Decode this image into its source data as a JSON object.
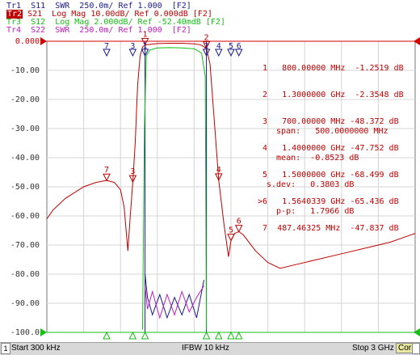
{
  "traces": [
    {
      "id": "tr1",
      "text": "Tr1  S11  SWR  250.0m/ Ref 1.000  [F2]",
      "color": "#1b1b8a"
    },
    {
      "id": "tr2",
      "tag": "Tr2",
      "text": " S21  Log Mag 10.00dB/ Ref 0.000dB [F2]",
      "color": "#c00000"
    },
    {
      "id": "tr3",
      "text": "Tr3  S12  Log Mag 2.000dB/ Ref -52.40mdB [F2]",
      "color": "#13c013"
    },
    {
      "id": "tr4",
      "text": "Tr4  S22  SWR  250.0m/ Ref 1.000  [F2]",
      "color": "#c020c0"
    }
  ],
  "y_labels": [
    "0.000",
    "-10.00",
    "-20.00",
    "-30.00",
    "-40.00",
    "-50.00",
    "-60.00",
    "-70.00",
    "-80.00",
    "-90.00",
    "-100.0"
  ],
  "marker_table": [
    " 1   800.00000 MHz  -1.2519 dB",
    " 2   1.3000000 GHz  -2.3548 dB",
    " 3   700.00000 MHz -48.372 dB",
    " 4   1.4000000 GHz -47.752 dB",
    " 5   1.5000000 GHz -68.499 dB",
    ">6   1.5640339 GHz -65.436 dB",
    " 7  487.46325 MHz  -47.837 dB"
  ],
  "stats": [
    "  span:   500.0000000 MHz",
    "  mean:  -0.8523 dB",
    "s.dev:   0.3803 dB",
    "  p-p:   1.7966 dB"
  ],
  "status": {
    "channel": "1",
    "start": "Start 300 kHz",
    "ifbw": "IFBW 10 kHz",
    "stop": "Stop 3 GHz",
    "cor": "Cor"
  },
  "chart_data": {
    "type": "line",
    "x_range_hz": [
      300000,
      3000000000
    ],
    "ylim": [
      -100,
      0
    ],
    "y_unit": "dB",
    "grid": true,
    "series": [
      {
        "name": "S21",
        "color": "#c00000",
        "points": [
          [
            0.0003,
            -61
          ],
          [
            0.05,
            -58
          ],
          [
            0.15,
            -54
          ],
          [
            0.3,
            -50
          ],
          [
            0.4,
            -48.5
          ],
          [
            0.4875,
            -47.8
          ],
          [
            0.55,
            -48.5
          ],
          [
            0.6,
            -51
          ],
          [
            0.63,
            -57
          ],
          [
            0.66,
            -72
          ],
          [
            0.68,
            -60
          ],
          [
            0.7,
            -48.4
          ],
          [
            0.72,
            -35
          ],
          [
            0.74,
            -15
          ],
          [
            0.76,
            -5
          ],
          [
            0.78,
            -2
          ],
          [
            0.8,
            -1.25
          ],
          [
            0.9,
            -0.8
          ],
          [
            1.0,
            -0.7
          ],
          [
            1.1,
            -0.7
          ],
          [
            1.2,
            -0.9
          ],
          [
            1.25,
            -1.2
          ],
          [
            1.3,
            -2.35
          ],
          [
            1.33,
            -8
          ],
          [
            1.36,
            -25
          ],
          [
            1.4,
            -47.75
          ],
          [
            1.44,
            -62
          ],
          [
            1.48,
            -74
          ],
          [
            1.5,
            -68.5
          ],
          [
            1.53,
            -66
          ],
          [
            1.564,
            -65.4
          ],
          [
            1.6,
            -66.5
          ],
          [
            1.7,
            -72
          ],
          [
            1.8,
            -76
          ],
          [
            1.9,
            -78
          ],
          [
            2.0,
            -77
          ],
          [
            2.2,
            -75
          ],
          [
            2.4,
            -73
          ],
          [
            2.6,
            -71
          ],
          [
            2.8,
            -69
          ],
          [
            3.0,
            -66
          ]
        ]
      },
      {
        "name": "S12",
        "color": "#13c013",
        "points": [
          [
            0.78,
            -99
          ],
          [
            0.795,
            -30
          ],
          [
            0.81,
            -5
          ],
          [
            0.84,
            -3
          ],
          [
            0.9,
            -2.3
          ],
          [
            1.0,
            -2.2
          ],
          [
            1.1,
            -2.3
          ],
          [
            1.2,
            -2.6
          ],
          [
            1.26,
            -4
          ],
          [
            1.29,
            -12
          ],
          [
            1.3,
            -99
          ]
        ]
      },
      {
        "name": "S11",
        "color": "#1b1b8a",
        "points": [
          [
            0.8,
            -80
          ],
          [
            0.82,
            -88
          ],
          [
            0.86,
            -94
          ],
          [
            0.92,
            -87
          ],
          [
            0.98,
            -95
          ],
          [
            1.04,
            -88
          ],
          [
            1.1,
            -94
          ],
          [
            1.16,
            -87
          ],
          [
            1.22,
            -95
          ],
          [
            1.28,
            -82
          ]
        ]
      },
      {
        "name": "S22",
        "color": "#c020c0",
        "points": [
          [
            0.8,
            -84
          ],
          [
            0.82,
            -92
          ],
          [
            0.86,
            -86
          ],
          [
            0.92,
            -95
          ],
          [
            0.98,
            -87
          ],
          [
            1.04,
            -94
          ],
          [
            1.1,
            -86
          ],
          [
            1.16,
            -93
          ],
          [
            1.22,
            -88
          ],
          [
            1.28,
            -84
          ]
        ]
      }
    ],
    "markers": [
      {
        "id": "1",
        "x": 0.8,
        "y": -1.25
      },
      {
        "id": "2",
        "x": 1.3,
        "y": -2.35
      },
      {
        "id": "3",
        "x": 0.7,
        "y": -48.37
      },
      {
        "id": "4",
        "x": 1.4,
        "y": -47.75
      },
      {
        "id": "5",
        "x": 1.5,
        "y": -68.5
      },
      {
        "id": "6",
        "x": 1.564,
        "y": -65.44
      },
      {
        "id": "7",
        "x": 0.4875,
        "y": -47.84
      }
    ]
  }
}
